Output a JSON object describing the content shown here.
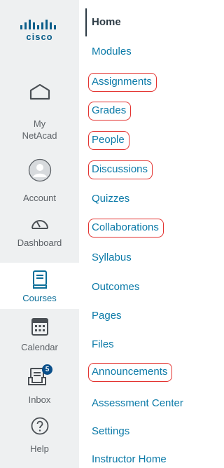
{
  "logo": {
    "wordmark": "cisco"
  },
  "global_nav": {
    "items": [
      {
        "key": "my_netacad",
        "label": "My\nNetAcad"
      },
      {
        "key": "account",
        "label": "Account"
      },
      {
        "key": "dashboard",
        "label": "Dashboard"
      },
      {
        "key": "courses",
        "label": "Courses"
      },
      {
        "key": "calendar",
        "label": "Calendar"
      },
      {
        "key": "inbox",
        "label": "Inbox",
        "badge": "5"
      },
      {
        "key": "help",
        "label": "Help"
      }
    ]
  },
  "course_nav": {
    "items": [
      {
        "label": "Home",
        "current": true,
        "highlighted": false
      },
      {
        "label": "Modules",
        "highlighted": false
      },
      {
        "label": "Assignments",
        "highlighted": true
      },
      {
        "label": "Grades",
        "highlighted": true
      },
      {
        "label": "People",
        "highlighted": true
      },
      {
        "label": "Discussions",
        "highlighted": true
      },
      {
        "label": "Quizzes",
        "highlighted": false
      },
      {
        "label": "Collaborations",
        "highlighted": true
      },
      {
        "label": "Syllabus",
        "highlighted": false
      },
      {
        "label": "Outcomes",
        "highlighted": false
      },
      {
        "label": "Pages",
        "highlighted": false
      },
      {
        "label": "Files",
        "highlighted": false
      },
      {
        "label": "Announcements",
        "highlighted": true
      },
      {
        "label": "Assessment Center",
        "highlighted": false
      },
      {
        "label": "Settings",
        "highlighted": false
      },
      {
        "label": "Instructor Home",
        "highlighted": false
      }
    ]
  },
  "colors": {
    "rail_bg": "#eef0f1",
    "link": "#0b7aa8",
    "highlight_circle": "#e3322f",
    "brand_blue": "#0b5e8a"
  }
}
